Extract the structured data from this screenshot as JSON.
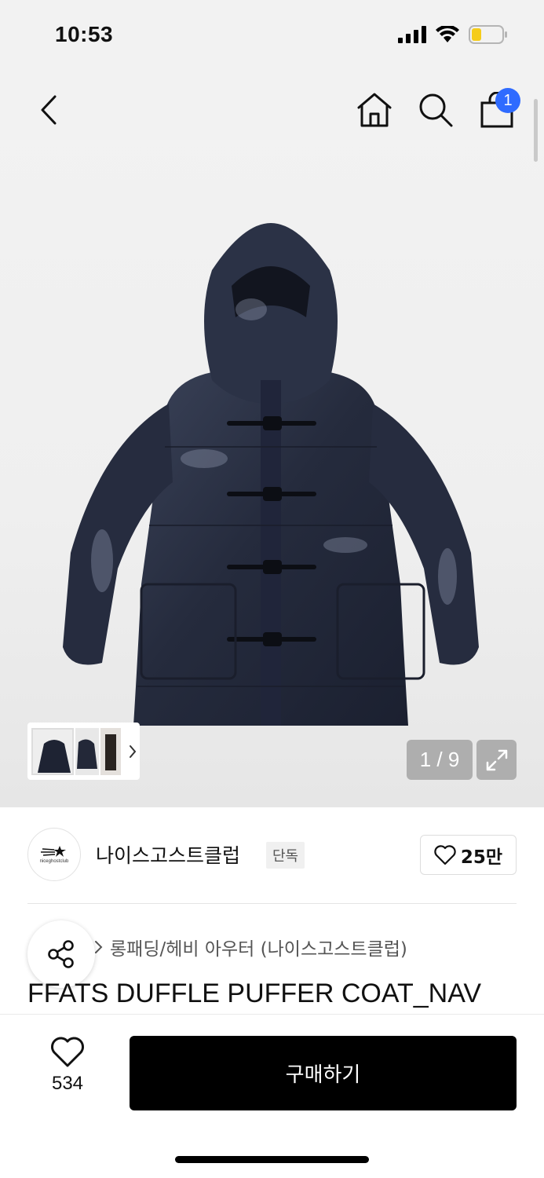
{
  "status": {
    "time": "10:53"
  },
  "header": {
    "back_icon": "chevron-left-icon",
    "home_icon": "home-icon",
    "search_icon": "search-icon",
    "cart_icon": "shopping-bag-icon",
    "cart_count": "1",
    "badge_color": "#2f6bff"
  },
  "gallery": {
    "counter": "1 / 9",
    "expand_icon": "expand-icon",
    "thumbnail_chevron": "chevron-right-icon"
  },
  "brand": {
    "logo_text": "niceghostclub",
    "name": "나이스고스트클럽",
    "tag": "단독",
    "likes": "25만"
  },
  "product": {
    "breadcrumb": "롱패딩/헤비 아우터 (나이스고스트클럽)",
    "title": "FFATS DUFFLE PUFFER COAT_NAV"
  },
  "bottom": {
    "wish_count": "534",
    "buy_label": "구매하기"
  }
}
